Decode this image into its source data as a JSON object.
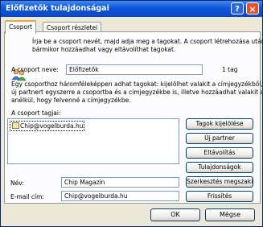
{
  "window": {
    "title": "Előfizetők tulajdonságai",
    "help_glyph": "?",
    "close_glyph": "×"
  },
  "tabs": [
    {
      "label": "Csoport",
      "active": true
    },
    {
      "label": "Csoport részletei",
      "active": false
    }
  ],
  "intro_text_line1": "Írja be a csoport nevét, majd adja meg a tagokat. A csoport létrehozása után",
  "intro_text_line2": "bármikor hozzáadhat vagy eltávolíthat tagokat.",
  "group_name": {
    "label": "A csoport neve:",
    "value": "Előfizetők",
    "member_count": "1 tag"
  },
  "desc_line1": "Egy csoporthoz háromféleképpen adhat tagokat: kijelölhet valakit a címjegyzékből, felvehet egy",
  "desc_line2": "új partnert egyszerre a csoportba és a címjegyzékbe is, illetve hozzáadhat valakit a csoporthoz",
  "desc_line3": "anélkül, hogy felvenné a címjegyzékbe.",
  "members": {
    "label": "A csoport tagjai:",
    "items": [
      "Chip@vogelburda.hu"
    ]
  },
  "buttons": {
    "select_members": "Tagok kijelölése",
    "new_contact": "Új partner",
    "remove": "Eltávolítás",
    "properties": "Tulajdonságok",
    "edit_changes": "Szerkesztés megszakítása",
    "update": "Frissítés"
  },
  "name_field": {
    "label": "Név:",
    "value": "Chip Magazin"
  },
  "email_field": {
    "label": "E-mail cím:",
    "value": "Chip@vogelburda.hu"
  },
  "footer": {
    "ok": "OK",
    "cancel": "Mégse"
  }
}
